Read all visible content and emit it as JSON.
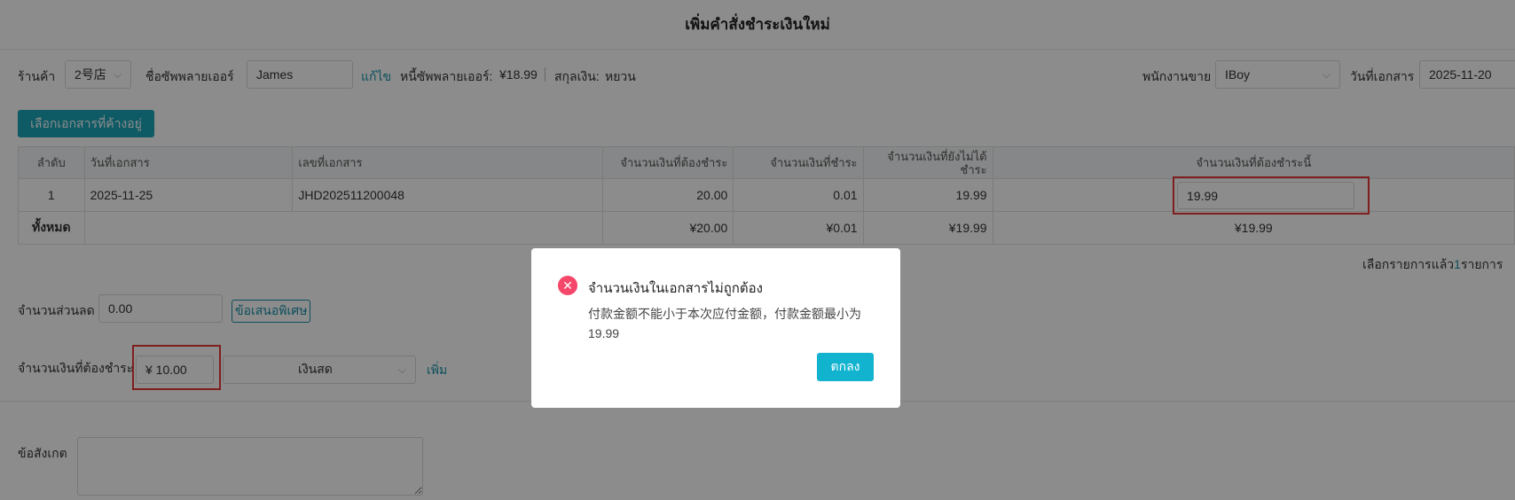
{
  "header": {
    "title": "เพิ่มคำสั่งชำระเงินใหม่"
  },
  "filters": {
    "store_label": "ร้านค้า",
    "store_value": "2号店",
    "supplier_label": "ชื่อซัพพลายเออร์",
    "supplier_value": "James",
    "edit_link": "แก้ไข",
    "debt_label": "หนี้ซัพพลายเออร์:",
    "debt_value": "¥18.99",
    "currency_label": "สกุลเงิน:",
    "currency_value": "หยวน",
    "salesperson_label": "พนักงานขาย",
    "salesperson_value": "IBoy",
    "doc_date_label": "วันที่เอกสาร",
    "doc_date_value": "2025-11-20"
  },
  "select_docs_button": "เลือกเอกสารที่ค้างอยู่",
  "table": {
    "columns": [
      "ลำดับ",
      "วันที่เอกสาร",
      "เลขที่เอกสาร",
      "จำนวนเงินที่ต้องชำระ",
      "จำนวนเงินที่ชำระ",
      "จำนวนเงินที่ยังไม่ได้ชำระ",
      "จำนวนเงินที่ต้องชำระนี้"
    ],
    "rows": [
      {
        "no": "1",
        "date": "2025-11-25",
        "doc_no": "JHD202511200048",
        "due": "20.00",
        "paid": "0.01",
        "unpaid": "19.99",
        "pay_now": "19.99"
      }
    ],
    "total": {
      "label": "ทั้งหมด",
      "due": "¥20.00",
      "paid": "¥0.01",
      "unpaid": "¥19.99",
      "pay_now": "¥19.99"
    }
  },
  "selected_summary": {
    "prefix": "เลือกรายการแล้ว",
    "count": "1",
    "suffix": "รายการ"
  },
  "discount": {
    "label": "จำนวนส่วนลด",
    "value": "0.00",
    "offer_link": "ข้อเสนอพิเศษ"
  },
  "payment": {
    "label": "จำนวนเงินที่ต้องชำระ",
    "amount": "¥ 10.00",
    "method": "เงินสด",
    "add_link": "เพิ่ม"
  },
  "note": {
    "label": "ข้อสังเกต",
    "value": ""
  },
  "dialog": {
    "title": "จำนวนเงินในเอกสารไม่ถูกต้อง",
    "message": "付款金额不能小于本次应付金额，付款金额最小为19.99",
    "ok": "ตกลง",
    "error_icon": "close-circle-icon",
    "error_color": "#f5476a"
  },
  "colors": {
    "accent": "#1aa5b8",
    "highlight": "#e53935"
  }
}
